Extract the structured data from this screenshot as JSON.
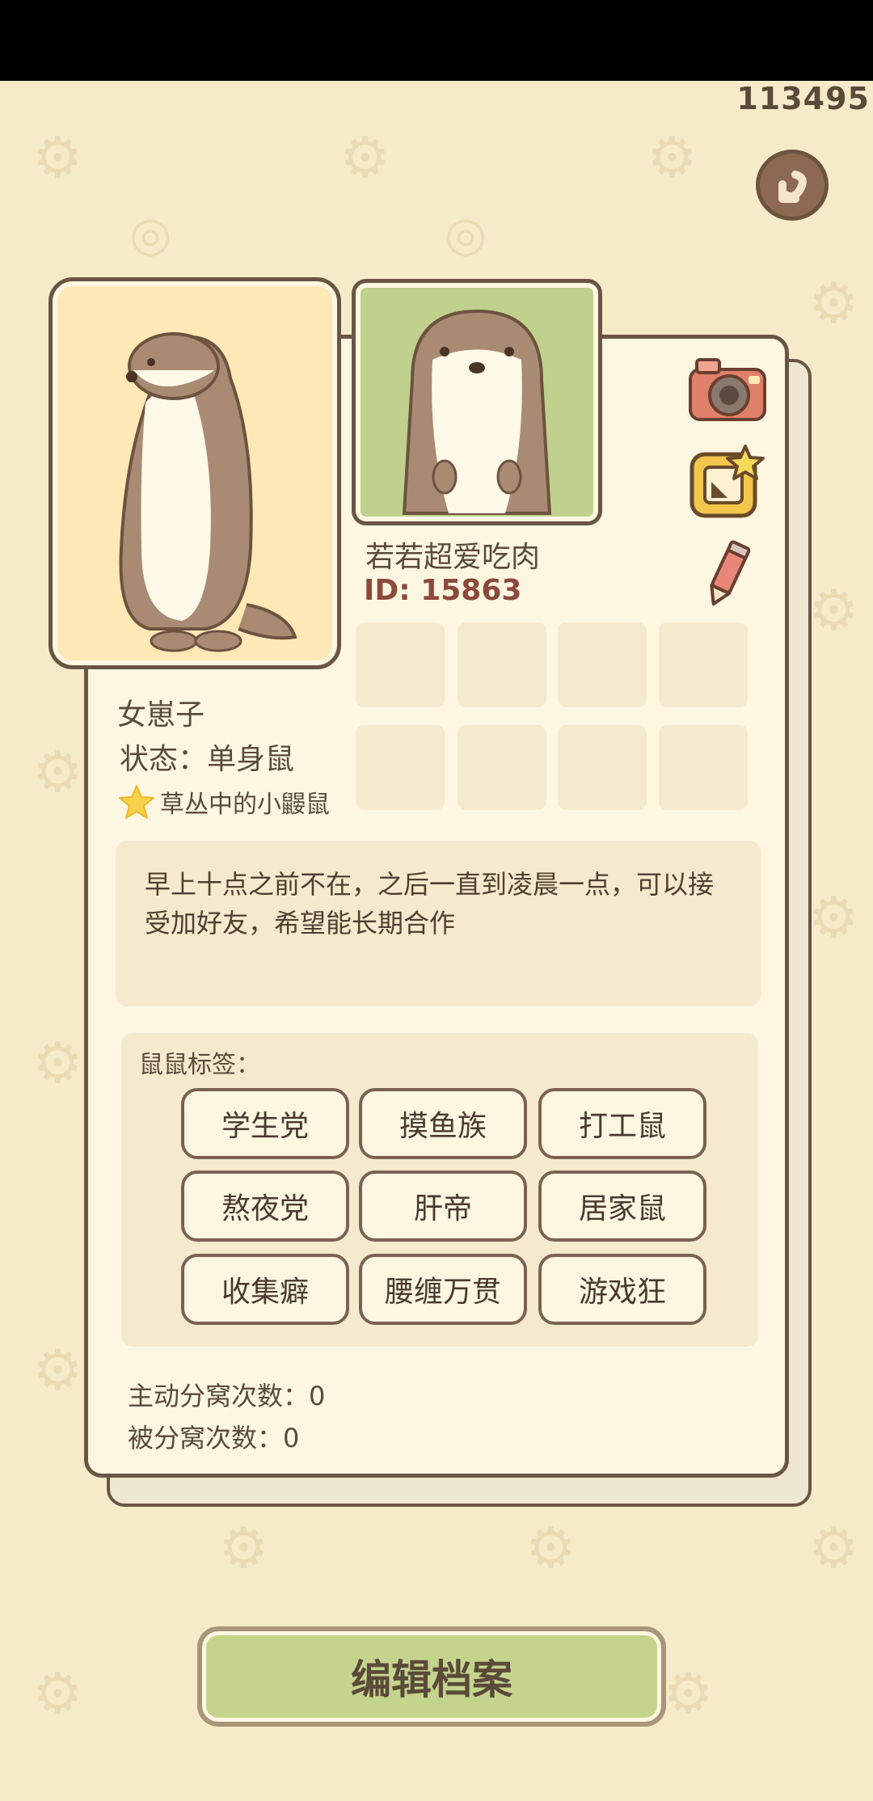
{
  "header": {
    "counter": "113495"
  },
  "profile": {
    "nickname": "若若超爱吃肉",
    "id_label": "ID: 15863",
    "gender": "女崽子",
    "status": "状态：单身鼠",
    "title": "草丛中的小鼹鼠",
    "bio": "早上十点之前不在，之后一直到凌晨一点，可以接受加好友，希望能长期合作"
  },
  "tags": {
    "title": "鼠鼠标签：",
    "items": [
      "学生党",
      "摸鱼族",
      "打工鼠",
      "熬夜党",
      "肝帝",
      "居家鼠",
      "收集癖",
      "腰缠万贯",
      "游戏狂"
    ]
  },
  "stats": {
    "active_split": "主动分窝次数：0",
    "passive_split": "被分窝次数：0"
  },
  "actions": {
    "edit_profile": "编辑档案"
  },
  "icons": {
    "back": "back-arrow-icon",
    "camera": "camera-icon",
    "frame": "frame-star-icon",
    "pencil": "pencil-icon",
    "star": "star-icon"
  },
  "colors": {
    "background": "#f6ebc9",
    "card": "#fdf7e2",
    "border": "#6a5545",
    "button": "#c5d48c",
    "id_text": "#8c4a3c"
  }
}
